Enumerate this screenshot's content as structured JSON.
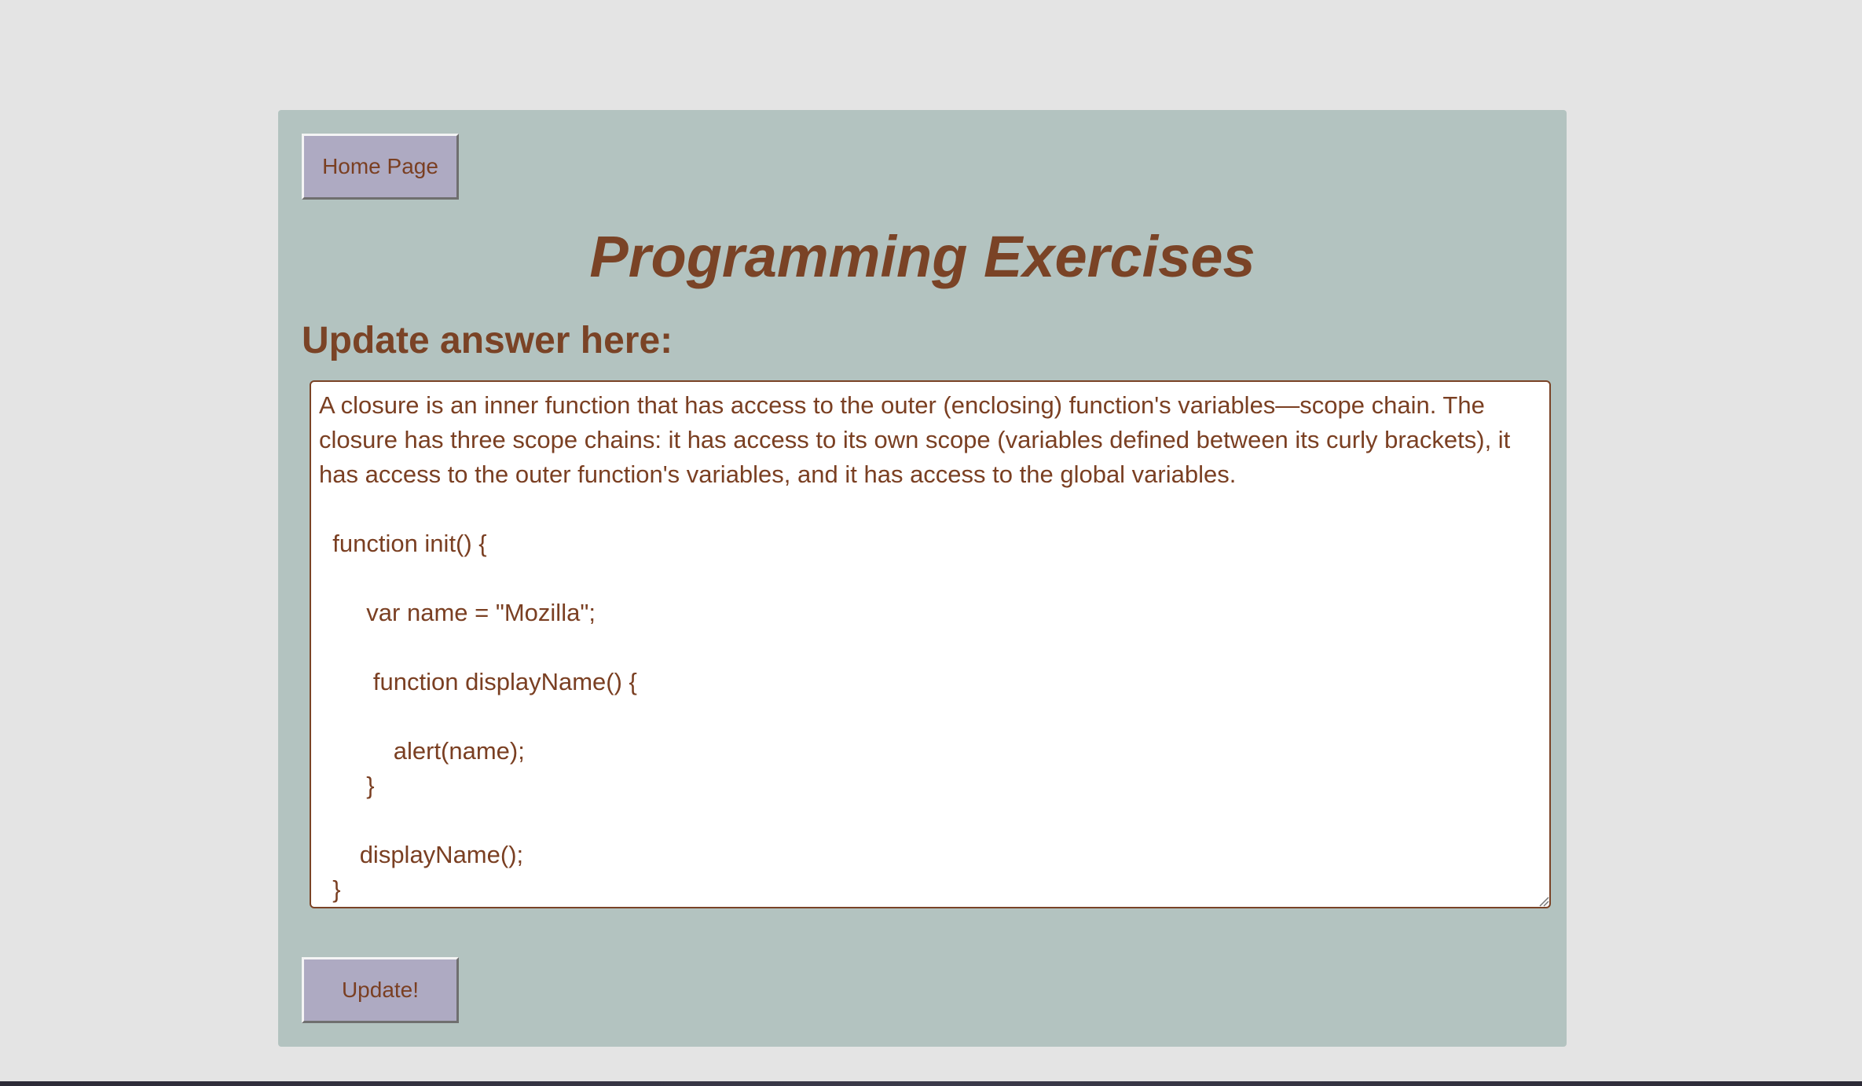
{
  "nav": {
    "home_label": "Home Page"
  },
  "page": {
    "title": "Programming Exercises",
    "subtitle": "Update answer here:"
  },
  "answer": {
    "text": "A closure is an inner function that has access to the outer (enclosing) function's variables—scope chain. The closure has three scope chains: it has access to its own scope (variables defined between its curly brackets), it has access to the outer function's variables, and it has access to the global variables.\n\n  function init() {\n\n       var name = \"Mozilla\";\n\n        function displayName() {\n\n           alert(name);\n       }\n\n      displayName();\n  }"
  },
  "actions": {
    "update_label": "Update!"
  },
  "colors": {
    "page_background": "#e4e4e4",
    "panel_background": "#b3c3c0",
    "text_brown": "#7a4326",
    "button_background": "#aeaac2"
  }
}
